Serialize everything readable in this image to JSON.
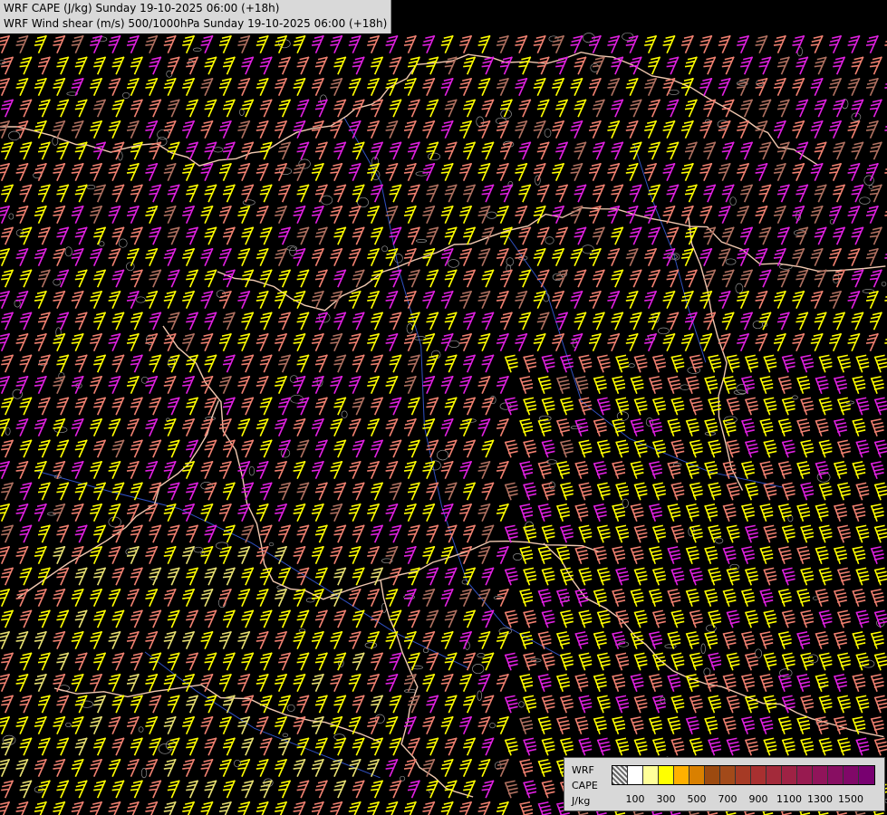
{
  "titles": {
    "line1": "WRF CAPE (J/kg) Sunday 19-10-2025 06:00 (+18h)",
    "line2": "WRF Wind shear (m/s) 500/1000hPa Sunday 19-10-2025 06:00 (+18h)"
  },
  "legend": {
    "label_model": "WRF",
    "label_field": "CAPE",
    "label_unit": "J/kg",
    "colors": [
      "hatch",
      "#ffffff",
      "#ffff99",
      "#ffff00",
      "#ffb000",
      "#d98000",
      "#9c4a10",
      "#a24a1a",
      "#a63a25",
      "#a83030",
      "#a32a3a",
      "#9e2244",
      "#981a50",
      "#90145a",
      "#880e62",
      "#800868",
      "#780070"
    ],
    "ticks": [
      "100",
      "300",
      "500",
      "700",
      "900",
      "1100",
      "1300",
      "1500"
    ]
  },
  "map": {
    "barb_colors": {
      "yellow": "#ffff00",
      "salmon": "#f08070",
      "magenta": "#e020e0",
      "pale_yellow": "#e8e070",
      "brown": "#b07060"
    },
    "border_color": "#f0c8b0",
    "river_color": "#3050c0",
    "contour_color": "#909090"
  }
}
